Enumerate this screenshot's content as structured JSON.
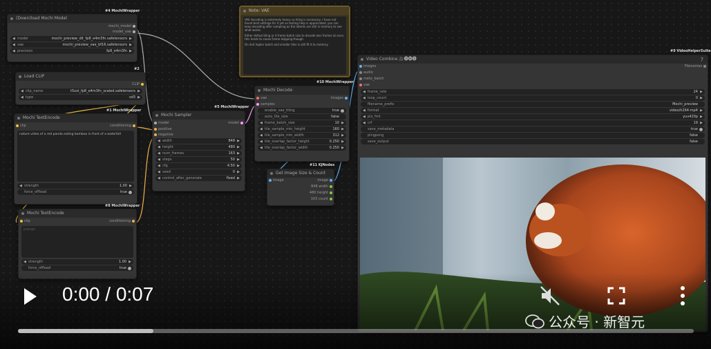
{
  "nodes": {
    "download_model": {
      "badge": "#4 MochiWrapper",
      "title": "(Down)load Mochi Model",
      "outputs": [
        "mochi_model",
        "model_vae"
      ],
      "widgets": [
        {
          "label": "model",
          "value": "mochi_preview_dit_fp8_e4m3fn.safetensors"
        },
        {
          "label": "vae",
          "value": "mochi_preview_vae_bf16.safetensors"
        },
        {
          "label": "precision",
          "value": "fp8_e4m3fn"
        }
      ]
    },
    "load_clip": {
      "badge": "#2",
      "title": "Load CLIP",
      "output": "CLIP",
      "widgets": [
        {
          "label": "clip_name",
          "value": "t5xxl_fp8_e4m3fn_scaled.safetensors"
        },
        {
          "label": "type",
          "value": "sd3"
        }
      ]
    },
    "text_encode_pos": {
      "badge": "#1 MochiWrapper",
      "title": "Mochi TextEncode",
      "input": "clip",
      "output": "conditioning",
      "text": "nature video of a red panda eating bamboo in front of a waterfall",
      "widgets": [
        {
          "label": "strength",
          "value": "1.00"
        }
      ],
      "toggle": {
        "label": "force_offload",
        "value": "true"
      }
    },
    "text_encode_neg": {
      "badge": "#8 MochiWrapper",
      "title": "Mochi TextEncode",
      "input": "clip",
      "output": "conditioning",
      "placeholder": "prompt",
      "widgets": [
        {
          "label": "strength",
          "value": "1.00"
        }
      ],
      "toggle": {
        "label": "force_offload",
        "value": "true"
      }
    },
    "sampler": {
      "badge": "#5 MochiWrapper",
      "title": "Mochi Sampler",
      "inputs": [
        "model",
        "positive",
        "negative"
      ],
      "output": "model",
      "widgets": [
        {
          "label": "width",
          "value": "848"
        },
        {
          "label": "height",
          "value": "480"
        },
        {
          "label": "num_frames",
          "value": "163"
        },
        {
          "label": "steps",
          "value": "50"
        },
        {
          "label": "cfg",
          "value": "4.50"
        },
        {
          "label": "seed",
          "value": "0"
        },
        {
          "label": "control_after_generate",
          "value": "fixed"
        }
      ]
    },
    "note": {
      "title": "Note: VAE",
      "text1": "VAE decoding is extremely heavy so tiling is necessary, I have not found best settings for it yet so testing help is appreciated, you can keep decoding after sampling as the latents are still in memory to see what works.",
      "text2": "Either defaut tiling or 4 frame batch size to decode less frames at once, this tends to cause frame skipping though.",
      "text3": "On 4x4 higher batch and smaller tiles is still fit it to memory."
    },
    "decode": {
      "badge": "#10 MochiWrapper",
      "title": "Mochi Decode",
      "inputs": [
        "vae",
        "samples"
      ],
      "output": "images",
      "toggles": [
        {
          "label": "enable_vae_tiling",
          "value": "true"
        },
        {
          "label": "auto_tile_size",
          "value": "false"
        }
      ],
      "widgets": [
        {
          "label": "frame_batch_size",
          "value": "10"
        },
        {
          "label": "tile_sample_min_height",
          "value": "160"
        },
        {
          "label": "tile_sample_min_width",
          "value": "312"
        },
        {
          "label": "tile_overlap_factor_height",
          "value": "0.250"
        },
        {
          "label": "tile_overlap_factor_width",
          "value": "0.250"
        }
      ]
    },
    "image_size": {
      "badge": "#11 KJNodes",
      "title": "Get Image Size & Count",
      "input": "image",
      "outputs": [
        "image",
        "848 width",
        "480 height",
        "163 count"
      ]
    },
    "video_combine": {
      "badge": "#9 VideoHelperSuite",
      "title": "Video Combine 🎥🅥🅗🅢",
      "inputs": [
        "images",
        "audio",
        "meta_batch",
        "vae"
      ],
      "output": "Filenames",
      "widgets": [
        {
          "label": "frame_rate",
          "value": "24"
        },
        {
          "label": "loop_count",
          "value": "0"
        },
        {
          "label": "filename_prefix",
          "value": "Mochi_preview"
        },
        {
          "label": "format",
          "value": "video/h264-mp4"
        },
        {
          "label": "pix_fmt",
          "value": "yuv420p"
        },
        {
          "label": "crf",
          "value": "19"
        }
      ],
      "toggles": [
        {
          "label": "save_metadata",
          "value": "true"
        },
        {
          "label": "pingpong",
          "value": "false"
        },
        {
          "label": "save_output",
          "value": "false"
        }
      ]
    }
  },
  "player": {
    "time": "0:00 / 0:07",
    "progress": 0.2,
    "watermark": "公众号 · 新智元"
  },
  "colors": {
    "clip_wire": "#f0c040",
    "cond_wire": "#f0b050",
    "model_wire": "#b0b0b0",
    "vae_wire": "#ff6e6e",
    "image_wire": "#64b5f6",
    "latent_wire": "#ff9cf9"
  }
}
